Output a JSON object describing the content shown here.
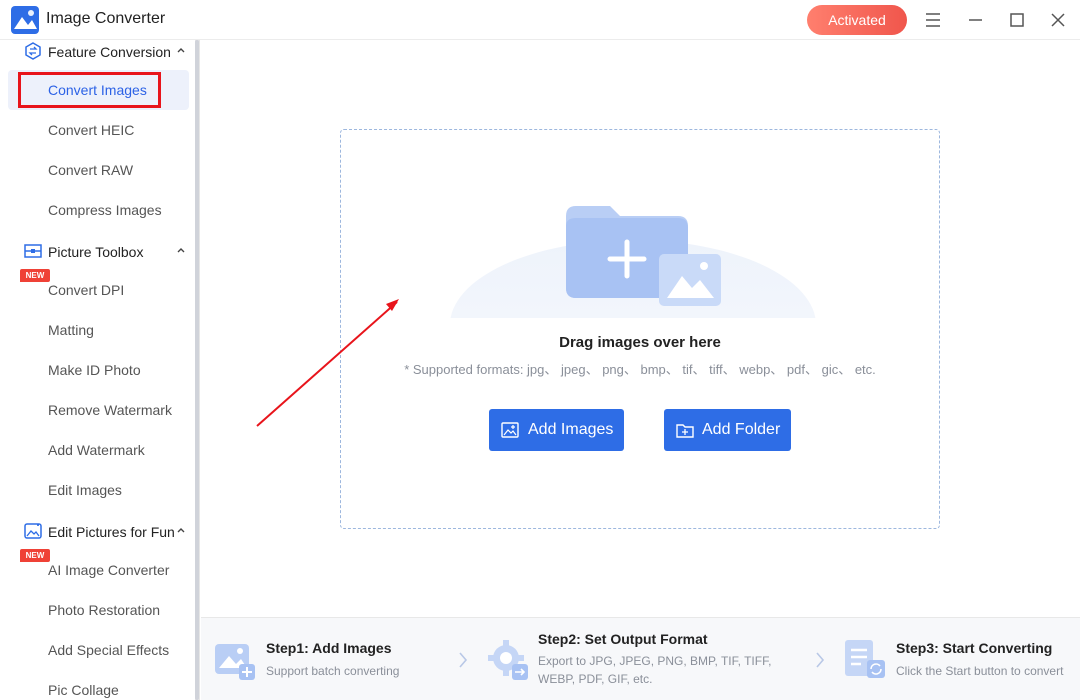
{
  "app": {
    "title": "Image Converter",
    "activated_label": "Activated"
  },
  "sidebar": {
    "sections": [
      {
        "label": "Feature Conversion"
      },
      {
        "label": "Picture Toolbox"
      },
      {
        "label": "Edit Pictures for Fun"
      }
    ],
    "items": [
      {
        "label": "Convert Images"
      },
      {
        "label": "Convert HEIC"
      },
      {
        "label": "Convert RAW"
      },
      {
        "label": "Compress Images"
      },
      {
        "label": "Convert DPI"
      },
      {
        "label": "Matting"
      },
      {
        "label": "Make ID Photo"
      },
      {
        "label": "Remove Watermark"
      },
      {
        "label": "Add Watermark"
      },
      {
        "label": "Edit Images"
      },
      {
        "label": "AI Image Converter"
      },
      {
        "label": "Photo Restoration"
      },
      {
        "label": "Add Special Effects"
      },
      {
        "label": "Pic Collage"
      }
    ],
    "new_badge": "NEW"
  },
  "drop": {
    "title": "Drag images over here",
    "formats": "* Supported formats: jpg、 jpeg、 png、 bmp、 tif、 tiff、 webp、 pdf、 gic、 etc.",
    "add_images": "Add Images",
    "add_folder": "Add Folder"
  },
  "steps": [
    {
      "title": "Step1:  Add Images",
      "desc": "Support batch converting"
    },
    {
      "title": "Step2:  Set Output Format",
      "desc": "Export to JPG, JPEG, PNG, BMP, TIF, TIFF, WEBP, PDF, GIF, etc."
    },
    {
      "title": "Step3:  Start Converting",
      "desc": "Click the Start button to convert"
    }
  ],
  "colors": {
    "accent": "#2e6de6",
    "activated": "#f0564c",
    "highlight": "#e8141b"
  }
}
